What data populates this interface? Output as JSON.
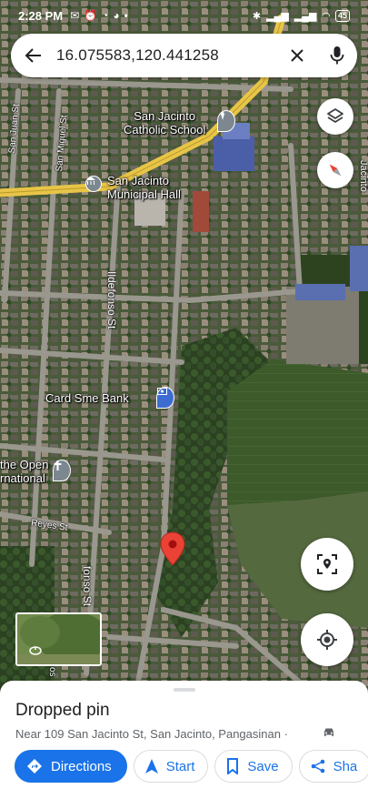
{
  "status_bar": {
    "time": "2:28 PM",
    "battery": "45"
  },
  "search": {
    "query": "16.075583,120.441258"
  },
  "map": {
    "places": {
      "church": "San Jacinto\nCatholic School",
      "hall": "San Jacinto\nMunicipal Hall",
      "bank": "Card Sme Bank",
      "school": "the Open\nrnational"
    },
    "streets": {
      "san_juan": "San Juan St",
      "san_miguel": "San Miguel St",
      "ildefonso": "Ildefonso St",
      "ildefonso_lower": "fonso St",
      "reyes": "Reyes St",
      "right_edge": "Jacinto",
      "left_edge": "os"
    }
  },
  "sheet": {
    "title": "Dropped pin",
    "address": "Near 109 San Jacinto St, San Jacinto, Pangasinan ·",
    "actions": {
      "directions": "Directions",
      "start": "Start",
      "save": "Save",
      "share": "Sha"
    }
  },
  "colors": {
    "accent": "#1a73e8",
    "pin": "#ea4335",
    "road_yellow": "#e8c547"
  }
}
